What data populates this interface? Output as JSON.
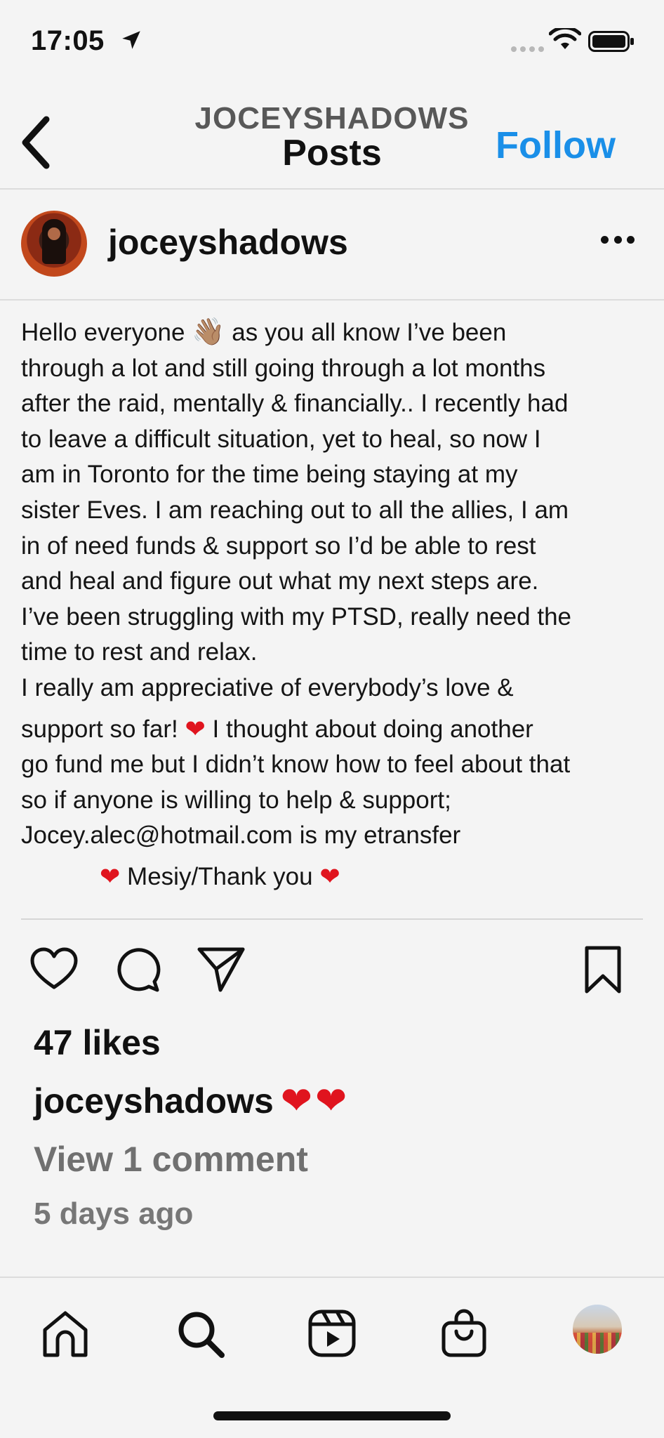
{
  "status_bar": {
    "time": "17:05",
    "icons": [
      "location-arrow-icon",
      "signal-icon",
      "wifi-icon",
      "battery-icon"
    ]
  },
  "header": {
    "back_icon": "chevron-left-icon",
    "title": "JOCEYSHADOWS",
    "subtitle": "Posts",
    "follow_label": "Follow",
    "follow_color": "#1a8fe8"
  },
  "post": {
    "username": "joceyshadows",
    "more_icon": "more-horizontal-icon",
    "body": {
      "l1_a": "Hello everyone ",
      "l1_emoji": "👋🏽",
      "l1_b": " as you all know I’ve been",
      "l2": "through a lot and still going through a lot months",
      "l3": "after the raid, mentally & financially.. I recently had",
      "l4": "to leave a difficult situation, yet to heal, so now I",
      "l5": "am in Toronto for the time being staying at my",
      "l6": "sister Eves. I am reaching out to all the allies, I am",
      "l7": "in of need funds & support so I’d be able to rest",
      "l8": "and heal and figure out what my next steps are.",
      "l9": "I’ve been struggling with my PTSD, really need the",
      "l10": "time to rest and relax.",
      "l11": "I really am appreciative of everybody’s love &",
      "l12_a": "support so far! ",
      "l12_heart": "❤",
      "l12_b": " I thought about doing another",
      "l13": "go fund me but I didn’t know how to feel about that",
      "l14": "so if anyone is willing to help & support;",
      "l15": "Jocey.alec@hotmail.com is my etransfer",
      "l16_heart1": "❤",
      "l16_text": " Mesiy/Thank you ",
      "l16_heart2": "❤"
    },
    "actions": {
      "like_icon": "heart-outline-icon",
      "comment_icon": "comment-bubble-icon",
      "share_icon": "paper-plane-icon",
      "save_icon": "bookmark-icon"
    },
    "likes": "47 likes",
    "caption_username": "joceyshadows",
    "caption_hearts": "❤❤",
    "view_comments": "View 1 comment",
    "timestamp": "5 days ago"
  },
  "tab_bar": {
    "items": [
      "home-icon",
      "search-icon",
      "reels-icon",
      "shop-bag-icon",
      "profile-avatar"
    ]
  },
  "colors": {
    "heart": "#e0141e",
    "background": "#f4f4f4"
  }
}
